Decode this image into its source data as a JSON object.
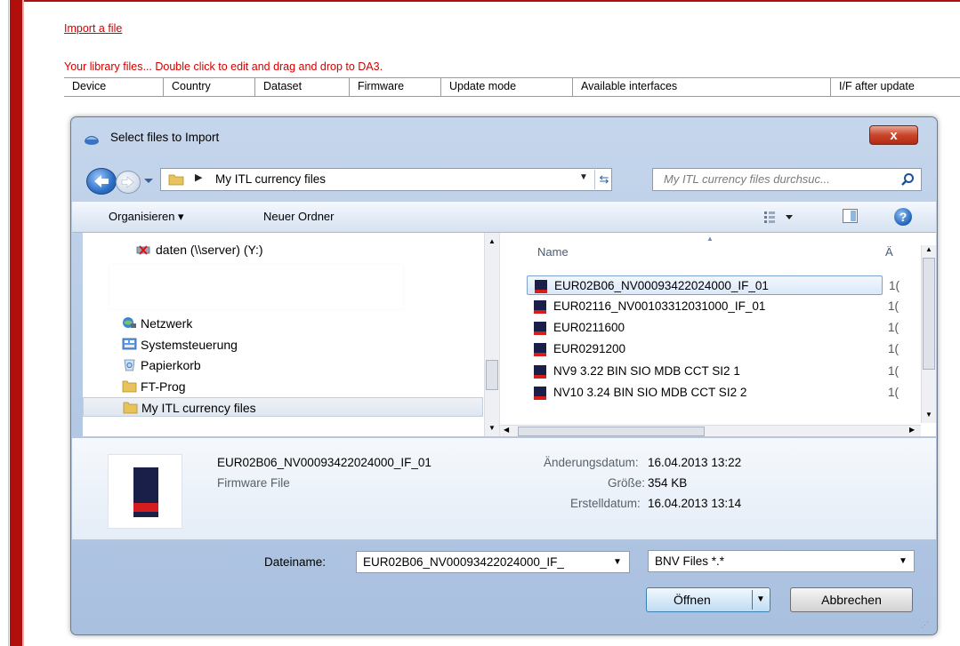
{
  "app": {
    "import_link": "Import a file",
    "library_text": "Your library files...  Double click to edit and drag and drop to DA3.",
    "columns": [
      "Device",
      "Country",
      "Dataset",
      "Firmware",
      "Update mode",
      "Available interfaces",
      "I/F after update"
    ]
  },
  "dialog": {
    "title": "Select files to Import",
    "close_label": "x",
    "address_path": "My ITL currency files",
    "search_placeholder": "My ITL currency files durchsuc...",
    "toolbar": {
      "organize": "Organisieren ▾",
      "new_folder": "Neuer Ordner"
    },
    "nav_items": [
      {
        "label": "daten (\\\\server) (Y:)",
        "icon": "network-drive-disconnected-icon"
      },
      {
        "label": "Netzwerk",
        "icon": "network-icon"
      },
      {
        "label": "Systemsteuerung",
        "icon": "control-panel-icon"
      },
      {
        "label": "Papierkorb",
        "icon": "recycle-bin-icon"
      },
      {
        "label": "FT-Prog",
        "icon": "folder-icon"
      },
      {
        "label": "My ITL currency files",
        "icon": "folder-icon",
        "selected": true
      }
    ],
    "file_list": {
      "name_header": "Name",
      "date_header": "Ä",
      "files": [
        {
          "name": "EUR02B06_NV00093422024000_IF_01",
          "date": "1(",
          "selected": true
        },
        {
          "name": "EUR02116_NV00103312031000_IF_01",
          "date": "1("
        },
        {
          "name": "EUR0211600",
          "date": "1("
        },
        {
          "name": "EUR0291200",
          "date": "1("
        },
        {
          "name": "NV9 3.22 BIN SIO MDB CCT SI2 1",
          "date": "1("
        },
        {
          "name": "NV10 3.24 BIN SIO MDB CCT SI2 2",
          "date": "1("
        }
      ]
    },
    "details": {
      "file_name": "EUR02B06_NV00093422024000_IF_01",
      "file_type": "Firmware File",
      "modified_label": "Änderungsdatum:",
      "modified_value": "16.04.2013 13:22",
      "size_label": "Größe:",
      "size_value": "354 KB",
      "created_label": "Erstelldatum:",
      "created_value": "16.04.2013 13:14"
    },
    "filename_label": "Dateiname:",
    "filename_value": "EUR02B06_NV00093422024000_IF_",
    "filetype_value": "BNV Files *.*",
    "open_label": "Öffnen",
    "cancel_label": "Abbrechen"
  },
  "colors": {
    "accent_red": "#b10e0e",
    "link_red": "#d40000",
    "selection_blue": "#7da2ce"
  }
}
